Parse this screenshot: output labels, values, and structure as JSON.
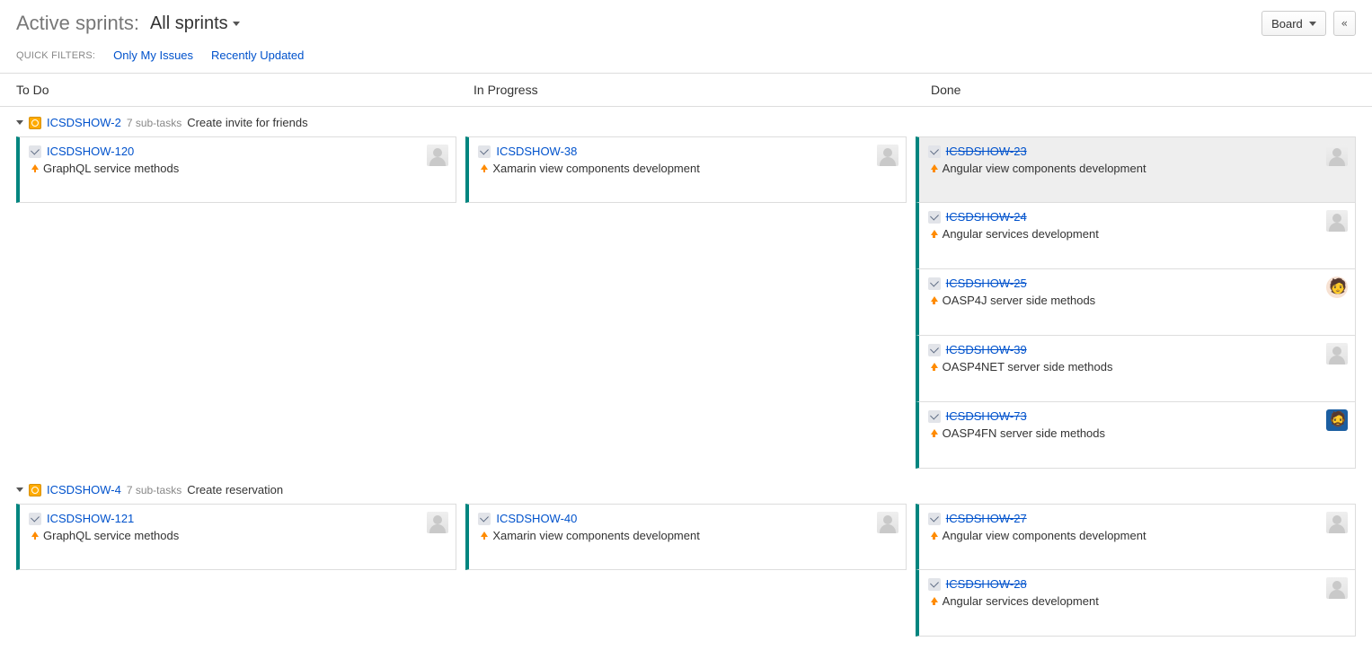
{
  "header": {
    "title": "Active sprints:",
    "sprint_dropdown": "All sprints",
    "board_button": "Board",
    "collapse_icon": "«"
  },
  "filters": {
    "label": "QUICK FILTERS:",
    "items": [
      "Only My Issues",
      "Recently Updated"
    ]
  },
  "columns": [
    "To Do",
    "In Progress",
    "Done"
  ],
  "swimlanes": [
    {
      "key": "ICSDSHOW-2",
      "subtasks_meta": "7 sub-tasks",
      "title": "Create invite for friends",
      "cols": [
        [
          {
            "key": "ICSDSHOW-120",
            "summary": "GraphQL service methods",
            "done": false,
            "avatar": "default"
          }
        ],
        [
          {
            "key": "ICSDSHOW-38",
            "summary": "Xamarin view components development",
            "done": false,
            "avatar": "default"
          }
        ],
        [
          {
            "key": "ICSDSHOW-23",
            "summary": "Angular view components development",
            "done": true,
            "avatar": "default",
            "selected": true
          },
          {
            "key": "ICSDSHOW-24",
            "summary": "Angular services development",
            "done": true,
            "avatar": "default"
          },
          {
            "key": "ICSDSHOW-25",
            "summary": "OASP4J server side methods",
            "done": true,
            "avatar": "img1"
          },
          {
            "key": "ICSDSHOW-39",
            "summary": "OASP4NET server side methods",
            "done": true,
            "avatar": "default"
          },
          {
            "key": "ICSDSHOW-73",
            "summary": "OASP4FN server side methods",
            "done": true,
            "avatar": "img2"
          }
        ]
      ]
    },
    {
      "key": "ICSDSHOW-4",
      "subtasks_meta": "7 sub-tasks",
      "title": "Create reservation",
      "cols": [
        [
          {
            "key": "ICSDSHOW-121",
            "summary": "GraphQL service methods",
            "done": false,
            "avatar": "default"
          }
        ],
        [
          {
            "key": "ICSDSHOW-40",
            "summary": "Xamarin view components development",
            "done": false,
            "avatar": "default"
          }
        ],
        [
          {
            "key": "ICSDSHOW-27",
            "summary": "Angular view components development",
            "done": true,
            "avatar": "default"
          },
          {
            "key": "ICSDSHOW-28",
            "summary": "Angular services development",
            "done": true,
            "avatar": "default"
          }
        ]
      ]
    }
  ]
}
